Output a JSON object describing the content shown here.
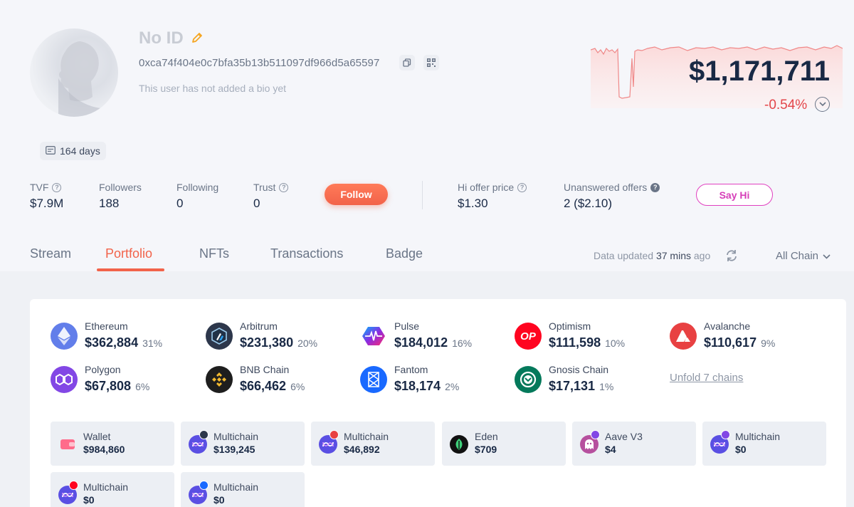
{
  "profile": {
    "name": "No ID",
    "address": "0xca74f404e0c7bfa35b13b511097df966d5a65597",
    "bio": "This user has not added a bio yet",
    "days": "164 days",
    "balance": "$1,171,711",
    "change": "-0.54%"
  },
  "stats": {
    "tvf_label": "TVF",
    "tvf_value": "$7.9M",
    "followers_label": "Followers",
    "followers_value": "188",
    "following_label": "Following",
    "following_value": "0",
    "trust_label": "Trust",
    "trust_value": "0",
    "follow_button": "Follow",
    "hi_offer_label": "Hi offer price",
    "hi_offer_value": "$1.30",
    "unanswered_label": "Unanswered offers",
    "unanswered_value": "2 ($2.10)",
    "say_hi_button": "Say Hi"
  },
  "tabs": [
    "Stream",
    "Portfolio",
    "NFTs",
    "Transactions",
    "Badge"
  ],
  "active_tab": "Portfolio",
  "data_updated": {
    "prefix": "Data updated ",
    "time": "37 mins",
    "suffix": " ago"
  },
  "chain_filter": "All Chain",
  "chains": [
    {
      "name": "Ethereum",
      "value": "$362,884",
      "pct": "31%",
      "icon": "ethereum-icon",
      "color": "#627eea"
    },
    {
      "name": "Arbitrum",
      "value": "$231,380",
      "pct": "20%",
      "icon": "arbitrum-icon",
      "color": "#2d374b"
    },
    {
      "name": "Pulse",
      "value": "$184,012",
      "pct": "16%",
      "icon": "pulse-icon",
      "color": "#e02fa8"
    },
    {
      "name": "Optimism",
      "value": "$111,598",
      "pct": "10%",
      "icon": "optimism-icon",
      "color": "#ff0420"
    },
    {
      "name": "Avalanche",
      "value": "$110,617",
      "pct": "9%",
      "icon": "avalanche-icon",
      "color": "#e84142"
    },
    {
      "name": "Polygon",
      "value": "$67,808",
      "pct": "6%",
      "icon": "polygon-icon",
      "color": "#8247e5"
    },
    {
      "name": "BNB Chain",
      "value": "$66,462",
      "pct": "6%",
      "icon": "bnb-icon",
      "color": "#f3ba2f"
    },
    {
      "name": "Fantom",
      "value": "$18,174",
      "pct": "2%",
      "icon": "fantom-icon",
      "color": "#1969ff"
    },
    {
      "name": "Gnosis Chain",
      "value": "$17,131",
      "pct": "1%",
      "icon": "gnosis-icon",
      "color": "#04795b"
    }
  ],
  "unfold_label": "Unfold 7 chains",
  "protocols": [
    {
      "name": "Wallet",
      "value": "$984,860",
      "icon": "wallet-icon"
    },
    {
      "name": "Multichain",
      "value": "$139,245",
      "icon": "multichain-icon",
      "badge": "arbitrum-badge-icon"
    },
    {
      "name": "Multichain",
      "value": "$46,892",
      "icon": "multichain-icon",
      "badge": "avalanche-badge-icon"
    },
    {
      "name": "Eden",
      "value": "$709",
      "icon": "eden-icon"
    },
    {
      "name": "Aave V3",
      "value": "$4",
      "icon": "aave-ghost-icon"
    },
    {
      "name": "Multichain",
      "value": "$0",
      "icon": "multichain-icon"
    },
    {
      "name": "Multichain",
      "value": "$0",
      "icon": "multichain-icon",
      "badge": "optimism-badge-icon"
    },
    {
      "name": "Multichain",
      "value": "$0",
      "icon": "multichain-icon",
      "badge": "fantom-badge-icon"
    }
  ],
  "colors": {
    "accent": "#f2634a",
    "negative": "#e3454a",
    "sayhi": "#d63fb8"
  }
}
